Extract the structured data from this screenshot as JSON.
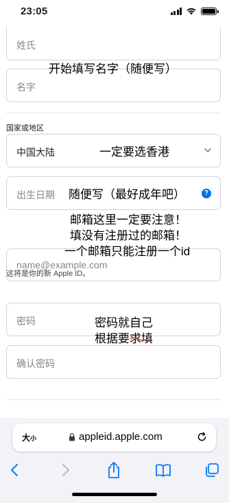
{
  "status_bar": {
    "time": "23:05"
  },
  "form": {
    "last_name_placeholder": "姓氏",
    "first_name_placeholder": "名字",
    "region_label": "国家或地区",
    "region_value": "中国大陆",
    "birthday_placeholder": "出生日期",
    "email_placeholder": "name@example.com",
    "email_hint": "这将是你的新 Apple ID。",
    "password_placeholder": "密码",
    "confirm_password_placeholder": "确认密码"
  },
  "annotations": {
    "name_note": "开始填写名字（随便写）",
    "region_note": "一定要选香港",
    "birthday_note": "随便写（最好成年吧）",
    "email_note_1": "邮箱这里一定要注意！",
    "email_note_2": "填没有注册过的邮箱！",
    "email_note_3": "一个邮箱只能注册一个id",
    "password_note_1": "密码就自己",
    "password_note_2": "根据要求填"
  },
  "browser": {
    "text_size_label": "大",
    "text_size_small": "小",
    "url": "appleid.apple.com"
  },
  "icons": {
    "help": "?",
    "accent_color": "#0071e3",
    "toolbar_tint": "#007aff"
  }
}
